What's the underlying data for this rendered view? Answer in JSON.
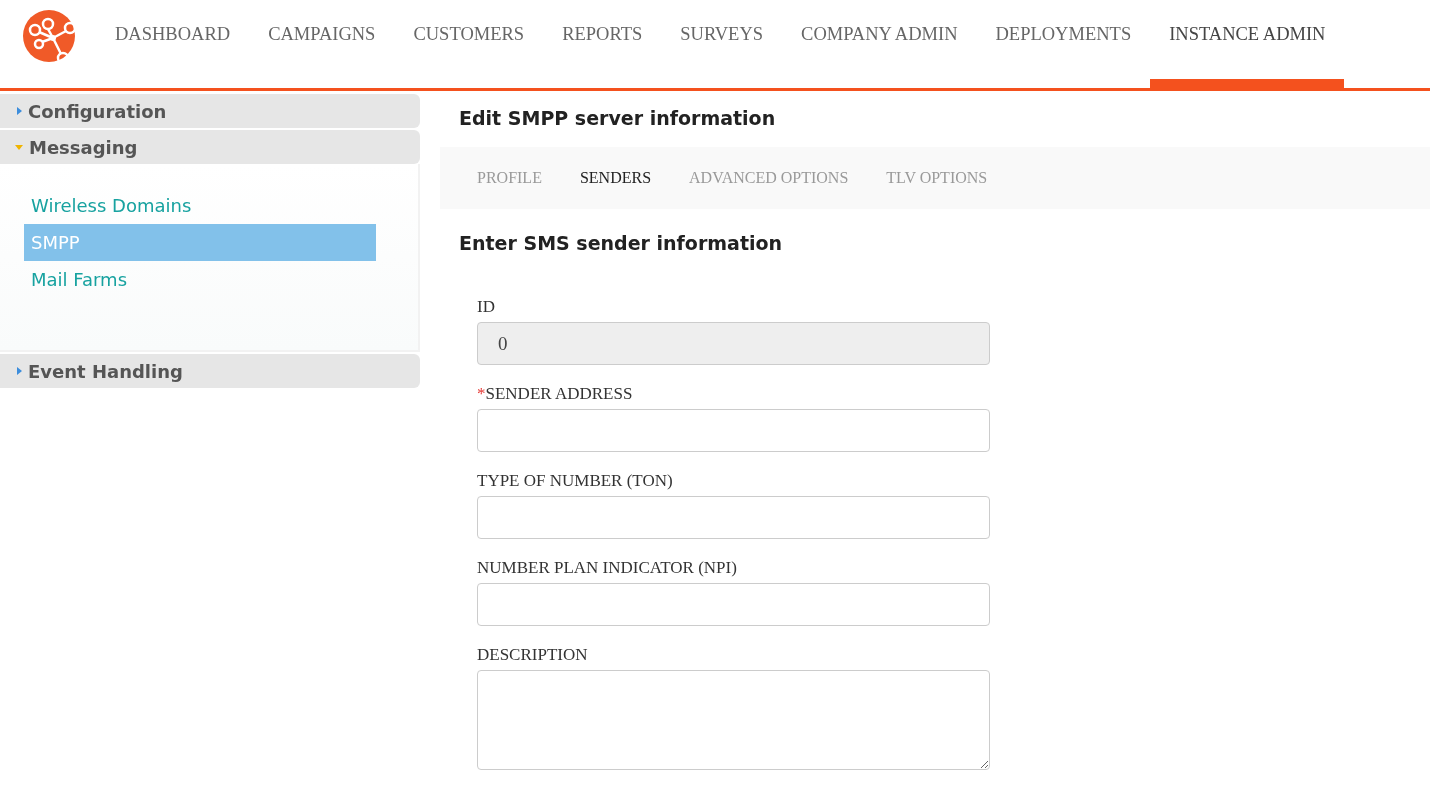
{
  "nav": [
    {
      "label": "DASHBOARD",
      "selected": false
    },
    {
      "label": "CAMPAIGNS",
      "selected": false
    },
    {
      "label": "CUSTOMERS",
      "selected": false
    },
    {
      "label": "REPORTS",
      "selected": false
    },
    {
      "label": "SURVEYS",
      "selected": false
    },
    {
      "label": "COMPANY ADMIN",
      "selected": false
    },
    {
      "label": "DEPLOYMENTS",
      "selected": false
    },
    {
      "label": "INSTANCE ADMIN",
      "selected": true
    }
  ],
  "sidebar": [
    {
      "title": "Configuration",
      "expanded": false
    },
    {
      "title": "Messaging",
      "expanded": true,
      "items": [
        {
          "label": "Wireless Domains",
          "selected": false
        },
        {
          "label": "SMPP",
          "selected": true
        },
        {
          "label": "Mail Farms",
          "selected": false
        }
      ]
    },
    {
      "title": "Event Handling",
      "expanded": false
    }
  ],
  "page_title": "Edit SMPP server information",
  "tabs": [
    {
      "label": "PROFILE",
      "selected": false
    },
    {
      "label": "SENDERS",
      "selected": true
    },
    {
      "label": "ADVANCED OPTIONS",
      "selected": false
    },
    {
      "label": "TLV OPTIONS",
      "selected": false
    }
  ],
  "section_title": "Enter SMS sender information",
  "fields": [
    {
      "kind": "input",
      "label": "ID",
      "value": "0",
      "disabled": true
    },
    {
      "kind": "input",
      "label": "SENDER ADDRESS",
      "required_mark": "*",
      "disabled": false
    },
    {
      "kind": "input",
      "label": "TYPE OF NUMBER (TON)",
      "disabled": false
    },
    {
      "kind": "input",
      "label": "NUMBER PLAN INDICATOR (NPI)",
      "disabled": false
    },
    {
      "kind": "textarea",
      "label": "DESCRIPTION",
      "disabled": false
    }
  ]
}
